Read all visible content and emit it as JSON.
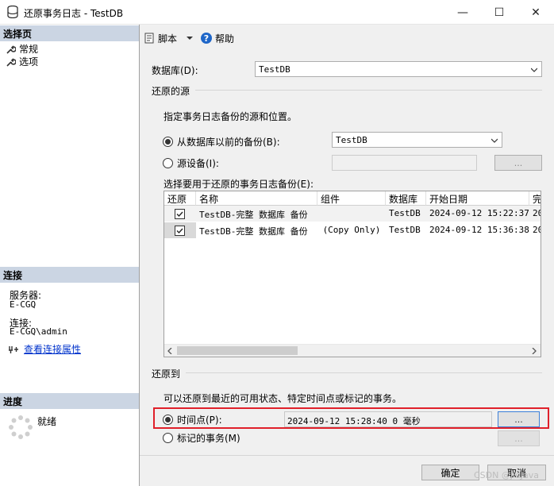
{
  "window": {
    "title": "还原事务日志 - TestDB",
    "minimize": "—",
    "maximize": "☐",
    "close": "✕"
  },
  "left": {
    "select_page_header": "选择页",
    "pages": [
      "常规",
      "选项"
    ],
    "connection_header": "连接",
    "server_label": "服务器:",
    "server_value": "E-CGQ",
    "connection_label": "连接:",
    "connection_value": "E-CGQ\\admin",
    "view_conn_props": "查看连接属性",
    "progress_header": "进度",
    "progress_status": "就绪"
  },
  "toolbar": {
    "script": "脚本",
    "help": "帮助"
  },
  "form": {
    "database_label": "数据库(D):",
    "database_value": "TestDB",
    "restore_source_group": "还原的源",
    "source_desc": "指定事务日志备份的源和位置。",
    "from_db_backup_label": "从数据库以前的备份(B):",
    "from_db_backup_value": "TestDB",
    "from_device_label": "源设备(I):",
    "browse": "...",
    "select_backups_label": "选择要用于还原的事务日志备份(E):",
    "restore_to_group": "还原到",
    "restore_to_desc": "可以还原到最近的可用状态、特定时间点或标记的事务。",
    "point_in_time_label": "时间点(P):",
    "point_in_time_value": "2024-09-12 15:28:40 0 毫秒",
    "marked_tx_label": "标记的事务(M)"
  },
  "grid": {
    "columns": [
      "还原",
      "名称",
      "组件",
      "数据库",
      "开始日期",
      "完"
    ],
    "rows": [
      {
        "restore": true,
        "name": "TestDB-完整 数据库 备份",
        "component": "",
        "database": "TestDB",
        "start_date": "2024-09-12 15:22:37",
        "finish": "20"
      },
      {
        "restore": true,
        "name": "TestDB-完整 数据库 备份",
        "component": "(Copy Only)",
        "database": "TestDB",
        "start_date": "2024-09-12 15:36:38",
        "finish": "20"
      }
    ]
  },
  "footer": {
    "ok": "确定",
    "cancel": "取消",
    "watermark": "CSDN @jieJava"
  },
  "colors": {
    "section_header": "#cbd5e3",
    "highlight_border": "#e0202a",
    "link": "#0033cc"
  }
}
